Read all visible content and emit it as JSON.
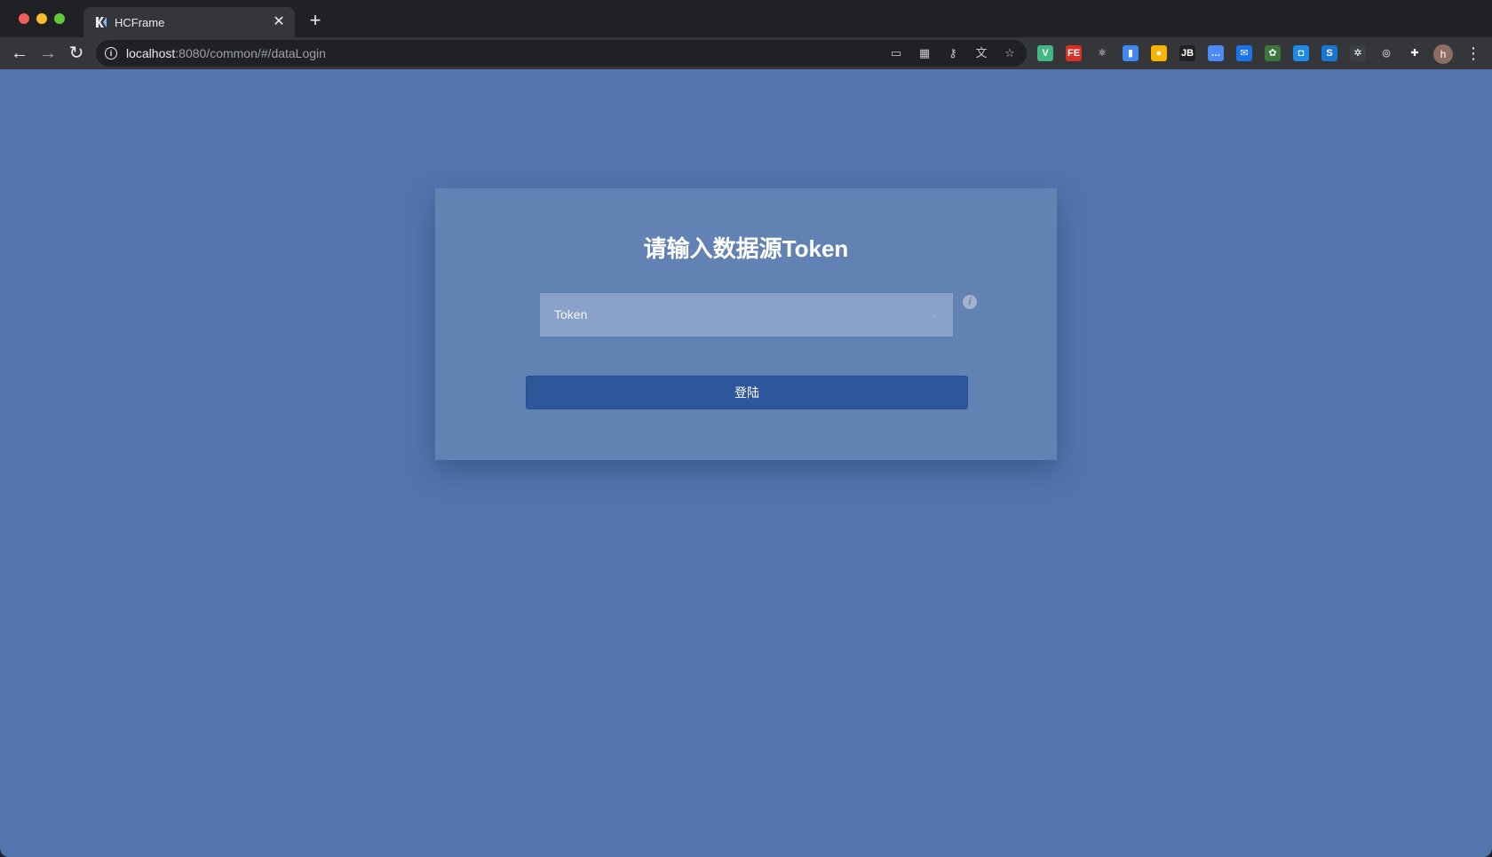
{
  "browser": {
    "tab": {
      "title": "HCFrame",
      "close_glyph": "✕"
    },
    "new_tab_glyph": "+",
    "nav": {
      "back": "←",
      "forward": "→",
      "reload": "↻"
    },
    "address": {
      "host": "localhost",
      "path": ":8080/common/#/dataLogin"
    },
    "omnibox_icons": [
      "cast-icon",
      "qr-code-icon",
      "key-icon",
      "translate-icon",
      "bookmark-star-icon"
    ],
    "extensions": [
      {
        "name": "vue-devtools-icon",
        "glyph": "V",
        "color": "#41b883"
      },
      {
        "name": "fe-helper-icon",
        "glyph": "FE",
        "color": "#d93025"
      },
      {
        "name": "react-devtools-icon",
        "glyph": "⚛",
        "color": "#35363a"
      },
      {
        "name": "bookmark-ext-icon",
        "glyph": "▮",
        "color": "#4285f4"
      },
      {
        "name": "color-picker-icon",
        "glyph": "●",
        "color": "#f4b400"
      },
      {
        "name": "jetbrains-icon",
        "glyph": "JB",
        "color": "#202124"
      },
      {
        "name": "chat-bubble-icon",
        "glyph": "…",
        "color": "#4c8bf5"
      },
      {
        "name": "mail-checker-icon",
        "glyph": "✉",
        "color": "#1a73e8"
      },
      {
        "name": "leaf-ext-icon",
        "glyph": "✿",
        "color": "#3c763d"
      },
      {
        "name": "capture-ext-icon",
        "glyph": "◘",
        "color": "#1e88e5"
      },
      {
        "name": "s-ext-icon",
        "glyph": "S",
        "color": "#1976d2"
      },
      {
        "name": "gear-ext-icon",
        "glyph": "✲",
        "color": "#3c4043"
      },
      {
        "name": "circle-ext-icon",
        "glyph": "◎",
        "color": "#35363a"
      },
      {
        "name": "puzzle-icon",
        "glyph": "✚",
        "color": "#35363a"
      }
    ],
    "avatar_initial": "h",
    "menu_glyph": "⋮"
  },
  "page": {
    "title": "请输入数据源Token",
    "token_select": {
      "placeholder": "Token",
      "chevron": "⌄"
    },
    "help_glyph": "i",
    "login_button": "登陆"
  },
  "colors": {
    "page_bg": "#5275ae",
    "card_bg": "#6282b4",
    "input_bg": "#8aa2ca",
    "button_bg": "#2d569b"
  }
}
